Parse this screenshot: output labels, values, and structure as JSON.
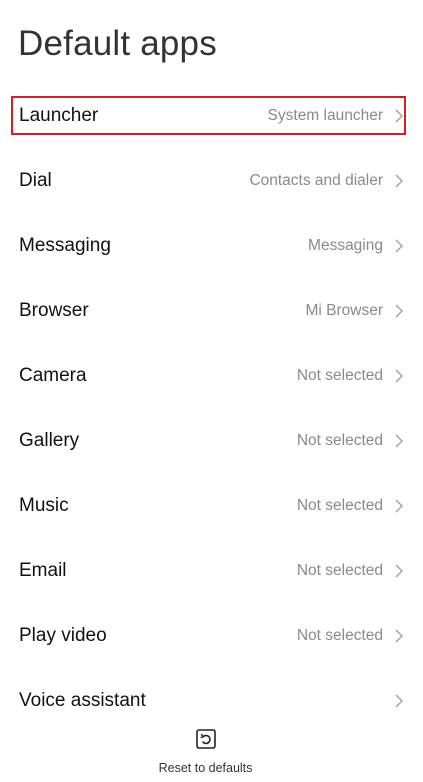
{
  "header": {
    "title": "Default apps"
  },
  "items": [
    {
      "label": "Launcher",
      "value": "System launcher",
      "highlight": true
    },
    {
      "label": "Dial",
      "value": "Contacts and dialer"
    },
    {
      "label": "Messaging",
      "value": "Messaging"
    },
    {
      "label": "Browser",
      "value": "Mi Browser"
    },
    {
      "label": "Camera",
      "value": "Not selected"
    },
    {
      "label": "Gallery",
      "value": "Not selected"
    },
    {
      "label": "Music",
      "value": "Not selected"
    },
    {
      "label": "Email",
      "value": "Not selected"
    },
    {
      "label": "Play video",
      "value": "Not selected"
    },
    {
      "label": "Voice assistant",
      "value": ""
    }
  ],
  "footer": {
    "reset_label": "Reset to defaults",
    "reset_icon": "reset-icon"
  },
  "colors": {
    "highlight_border": "#d0202a",
    "value_text": "#8a8a8a",
    "chevron": "#a0a0a0"
  }
}
